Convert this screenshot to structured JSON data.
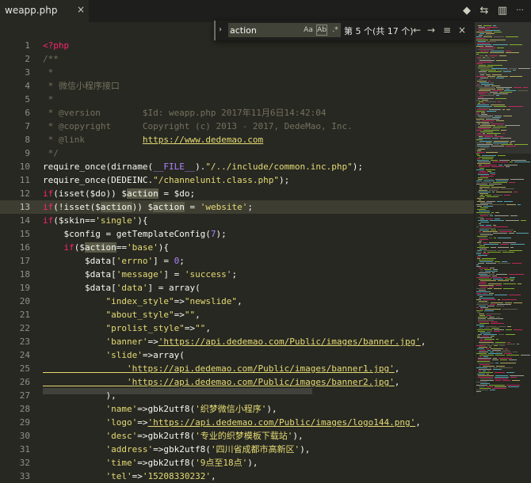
{
  "tab": {
    "title": "weapp.php",
    "close": "×"
  },
  "toolbar": {
    "icons": [
      "source-control",
      "open-changes",
      "split-editor",
      "more"
    ],
    "glyphs": [
      "◆",
      "⇆",
      "▥",
      "···"
    ]
  },
  "find": {
    "toggle": "›",
    "query": "action",
    "match_case": "Aa",
    "whole_word": "Ab",
    "regex": ".*",
    "count": "第 5 个(共 17 个)",
    "prev": "←",
    "next": "→",
    "in_selection": "≡",
    "close": "×"
  },
  "editor": {
    "current_line": 13,
    "lines": [
      {
        "n": "1",
        "t": [
          [
            "k",
            "<?php"
          ]
        ]
      },
      {
        "n": "2",
        "t": [
          [
            "c",
            "/**"
          ]
        ]
      },
      {
        "n": "3",
        "t": [
          [
            "c",
            " *"
          ]
        ]
      },
      {
        "n": "4",
        "t": [
          [
            "c",
            " * 微信小程序接口"
          ]
        ]
      },
      {
        "n": "5",
        "t": [
          [
            "c",
            " *"
          ]
        ]
      },
      {
        "n": "6",
        "t": [
          [
            "c",
            " * @version        $Id: weapp.php 2017年11月6日14:42:04"
          ]
        ]
      },
      {
        "n": "7",
        "t": [
          [
            "c",
            " * @copyright      Copyright (c) 2013 - 2017, DedeMao, Inc."
          ]
        ]
      },
      {
        "n": "8",
        "t": [
          [
            "c",
            " * @link           "
          ],
          [
            "cu",
            "https://www.dedemao.com"
          ]
        ]
      },
      {
        "n": "9",
        "t": [
          [
            "c",
            " */"
          ]
        ]
      },
      {
        "n": "10",
        "t": [
          [
            "",
            "require_once(dirname("
          ],
          [
            "n",
            "__FILE__"
          ],
          [
            "",
            ")."
          ],
          [
            "s",
            "\"/../include/common.inc.php\""
          ],
          [
            "",
            ");"
          ]
        ]
      },
      {
        "n": "11",
        "t": [
          [
            "",
            "require_once(DEDEINC."
          ],
          [
            "s",
            "\"/channelunit.class.php\""
          ],
          [
            "",
            ");"
          ]
        ]
      },
      {
        "n": "12",
        "t": [
          [
            "k",
            "if"
          ],
          [
            "",
            "(isset($do)) $"
          ],
          [
            "h",
            "action"
          ],
          [
            "",
            " = $do;"
          ]
        ]
      },
      {
        "n": "13",
        "t": [
          [
            "k",
            "if"
          ],
          [
            "",
            "(!isset($"
          ],
          [
            "h",
            "action"
          ],
          [
            "",
            ")) $"
          ],
          [
            "h",
            "action"
          ],
          [
            "",
            " = "
          ],
          [
            "s",
            "'website'"
          ],
          [
            "",
            ";"
          ]
        ]
      },
      {
        "n": "14",
        "t": [
          [
            "k",
            "if"
          ],
          [
            "",
            "($skin=="
          ],
          [
            "s",
            "'single'"
          ],
          [
            "",
            "){"
          ]
        ]
      },
      {
        "n": "15",
        "t": [
          [
            "",
            "    $config = getTemplateConfig("
          ],
          [
            "n",
            "7"
          ],
          [
            "",
            ");"
          ]
        ]
      },
      {
        "n": "16",
        "t": [
          [
            "k",
            "    if"
          ],
          [
            "",
            "($"
          ],
          [
            "h",
            "action"
          ],
          [
            "",
            "=="
          ],
          [
            "s",
            "'base'"
          ],
          [
            "",
            "){"
          ]
        ]
      },
      {
        "n": "17",
        "t": [
          [
            "",
            "        $data["
          ],
          [
            "s",
            "'errno'"
          ],
          [
            "",
            "] = "
          ],
          [
            "n",
            "0"
          ],
          [
            "",
            ";"
          ]
        ]
      },
      {
        "n": "18",
        "t": [
          [
            "",
            "        $data["
          ],
          [
            "s",
            "'message'"
          ],
          [
            "",
            "] = "
          ],
          [
            "s",
            "'success'"
          ],
          [
            "",
            ";"
          ]
        ]
      },
      {
        "n": "19",
        "t": [
          [
            "",
            "        $data["
          ],
          [
            "s",
            "'data'"
          ],
          [
            "",
            "] = array("
          ]
        ]
      },
      {
        "n": "20",
        "t": [
          [
            "s",
            "            \"index_style\""
          ],
          [
            "",
            "=>"
          ],
          [
            "s",
            "\"newslide\""
          ],
          [
            "",
            ","
          ]
        ]
      },
      {
        "n": "21",
        "t": [
          [
            "s",
            "            \"about_style\""
          ],
          [
            "",
            "=>"
          ],
          [
            "s",
            "\"\""
          ],
          [
            "",
            ","
          ]
        ]
      },
      {
        "n": "22",
        "t": [
          [
            "s",
            "            \"prolist_style\""
          ],
          [
            "",
            "=>"
          ],
          [
            "s",
            "\"\""
          ],
          [
            "",
            ","
          ]
        ]
      },
      {
        "n": "23",
        "t": [
          [
            "s",
            "            'banner'"
          ],
          [
            "",
            "=>"
          ],
          [
            "u",
            "'https://api.dedemao.com/Public/images/banner.jpg'"
          ],
          [
            "",
            ","
          ]
        ]
      },
      {
        "n": "24",
        "t": [
          [
            "s",
            "            'slide'"
          ],
          [
            "",
            "=>array("
          ]
        ]
      },
      {
        "n": "25",
        "t": [
          [
            "u",
            "                'https://api.dedemao.com/Public/images/banner1.jpg'"
          ],
          [
            "",
            ","
          ]
        ]
      },
      {
        "n": "26",
        "t": [
          [
            "u",
            "                'https://api.dedemao.com/Public/images/banner2.jpg'"
          ],
          [
            "",
            ","
          ]
        ]
      },
      {
        "n": "27",
        "t": [
          [
            "",
            "            ),"
          ]
        ]
      },
      {
        "n": "28",
        "t": [
          [
            "s",
            "            'name'"
          ],
          [
            "",
            "=>gbk2utf8("
          ],
          [
            "s",
            "'织梦微信小程序'"
          ],
          [
            "",
            "),"
          ]
        ]
      },
      {
        "n": "29",
        "t": [
          [
            "s",
            "            'logo'"
          ],
          [
            "",
            "=>"
          ],
          [
            "u",
            "'https://api.dedemao.com/Public/images/logo144.png'"
          ],
          [
            "",
            ","
          ]
        ]
      },
      {
        "n": "30",
        "t": [
          [
            "s",
            "            'desc'"
          ],
          [
            "",
            "=>gbk2utf8("
          ],
          [
            "s",
            "'专业的织梦模板下载站'"
          ],
          [
            "",
            "),"
          ]
        ]
      },
      {
        "n": "31",
        "t": [
          [
            "s",
            "            'address'"
          ],
          [
            "",
            "=>gbk2utf8("
          ],
          [
            "s",
            "'四川省成都市高新区'"
          ],
          [
            "",
            "),"
          ]
        ]
      },
      {
        "n": "32",
        "t": [
          [
            "s",
            "            'time'"
          ],
          [
            "",
            "=>gbk2utf8("
          ],
          [
            "s",
            "'9点至18点'"
          ],
          [
            "",
            "),"
          ]
        ]
      },
      {
        "n": "33",
        "t": [
          [
            "s",
            "            'tel'"
          ],
          [
            "",
            "=>"
          ],
          [
            "s",
            "'15208330232'"
          ],
          [
            "",
            ","
          ]
        ]
      }
    ]
  },
  "colors": {
    "background": "#272822",
    "keyword": "#f92672",
    "string": "#e6db74",
    "comment": "#75715e",
    "number": "#ae81ff"
  }
}
